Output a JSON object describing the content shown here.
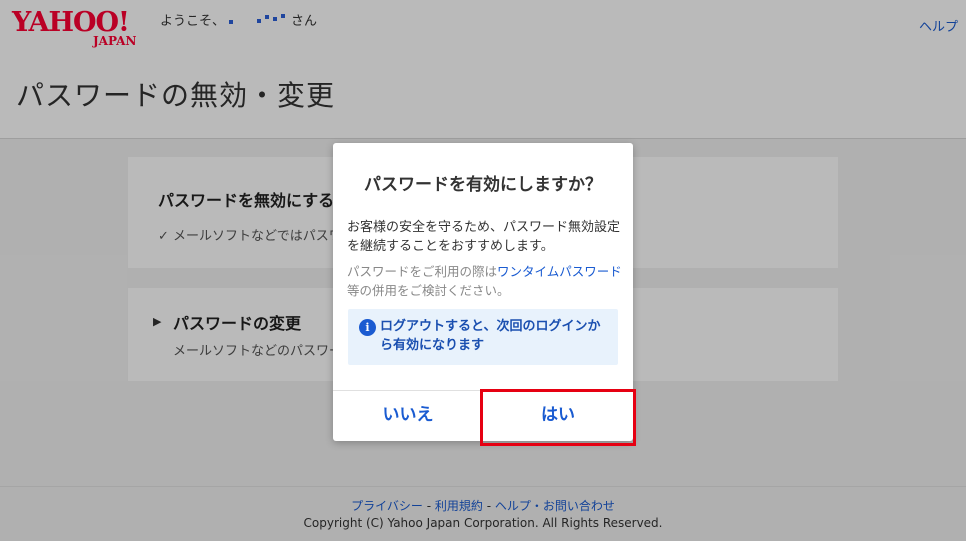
{
  "header": {
    "logo_yahoo": "YAHOO!",
    "logo_japan": "JAPAN",
    "welcome_prefix": "ようこそ、",
    "welcome_suffix": "さん",
    "help": "ヘルプ"
  },
  "page_title": "パスワードの無効・変更",
  "cards": {
    "disable": {
      "title": "パスワードを無効にする",
      "sub": "✓ メールソフトなどではパスワー"
    },
    "change": {
      "caret": "▶",
      "title": "パスワードの変更",
      "sub": "メールソフトなどのパスワー"
    }
  },
  "dialog": {
    "title": "パスワードを有効にしますか？",
    "body": "お客様の安全を守るため、パスワード無効設定を継続することをおすすめします。",
    "note_prefix": "パスワードをご利用の際は",
    "note_link": "ワンタイムパスワード",
    "note_suffix": "等の併用をご検討ください。",
    "info_icon": "i",
    "info_text": "ログアウトすると、次回のログインから有効になります",
    "no_label": "いいえ",
    "yes_label": "はい"
  },
  "footer": {
    "privacy": "プライバシー",
    "terms": "利用規約",
    "help_contact": "ヘルプ・お問い合わせ",
    "sep": " - ",
    "copyright": "Copyright (C) Yahoo Japan Corporation. All Rights Reserved."
  },
  "colors": {
    "brand_red": "#ff0033",
    "link_blue": "#1a5bd1",
    "highlight_red": "#e60012",
    "info_bg": "#e8f2fc"
  },
  "icons": {
    "info": "info-icon",
    "caret": "caret-right-icon",
    "check": "check-icon"
  }
}
